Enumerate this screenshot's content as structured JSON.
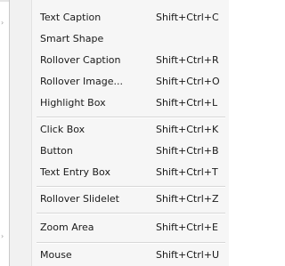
{
  "menu": {
    "items": [
      {
        "label": "Text Caption",
        "shortcut": "Shift+Ctrl+C"
      },
      {
        "label": "Smart Shape",
        "shortcut": ""
      },
      {
        "label": "Rollover Caption",
        "shortcut": "Shift+Ctrl+R"
      },
      {
        "label": "Rollover Image...",
        "shortcut": "Shift+Ctrl+O"
      },
      {
        "label": "Highlight Box",
        "shortcut": "Shift+Ctrl+L"
      },
      {
        "label": "Click Box",
        "shortcut": "Shift+Ctrl+K"
      },
      {
        "label": "Button",
        "shortcut": "Shift+Ctrl+B"
      },
      {
        "label": "Text Entry Box",
        "shortcut": "Shift+Ctrl+T"
      },
      {
        "label": "Rollover Slidelet",
        "shortcut": "Shift+Ctrl+Z"
      },
      {
        "label": "Zoom Area",
        "shortcut": "Shift+Ctrl+E"
      },
      {
        "label": "Mouse",
        "shortcut": "Shift+Ctrl+U"
      }
    ]
  }
}
